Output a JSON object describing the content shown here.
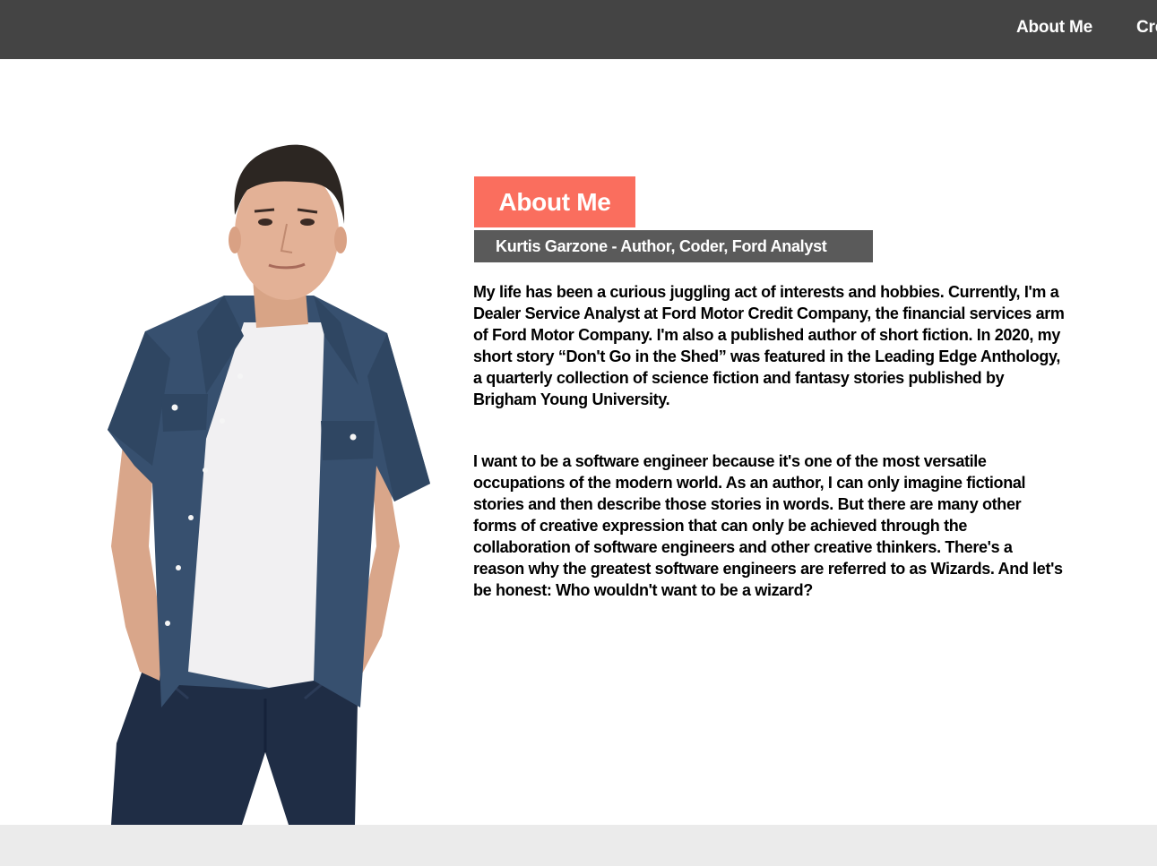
{
  "nav": {
    "items": [
      {
        "label": "About Me"
      },
      {
        "label": "Cre"
      }
    ]
  },
  "about": {
    "title": "About Me",
    "subtitle": "Kurtis Garzone - Author, Coder, Ford Analyst",
    "paragraphs": [
      "My life has been a curious juggling act of interests and hobbies. Currently, I'm a Dealer Service Analyst at Ford Motor Credit Company, the financial services arm of Ford Motor Company. I'm also a published author of short fiction. In 2020, my short story “Don't Go in the Shed” was featured in the Leading Edge Anthology, a quarterly collection of science fiction and fantasy stories published by Brigham Young University.",
      "I want to be a software engineer because it's one of the most versatile occupations of the modern world. As an author, I can only imagine fictional stories and then describe those stories in words. But there are many other forms of creative expression that can only be achieved through the collaboration of software engineers and other creative thinkers. There's a reason why the greatest software engineers are referred to as Wizards. And let's be honest: Who wouldn't want to be a wizard?"
    ]
  },
  "colors": {
    "navbar": "#444444",
    "accent": "#fa6e5e",
    "subtitle_bg": "#5a5a5a",
    "footer": "#ebebeb"
  }
}
